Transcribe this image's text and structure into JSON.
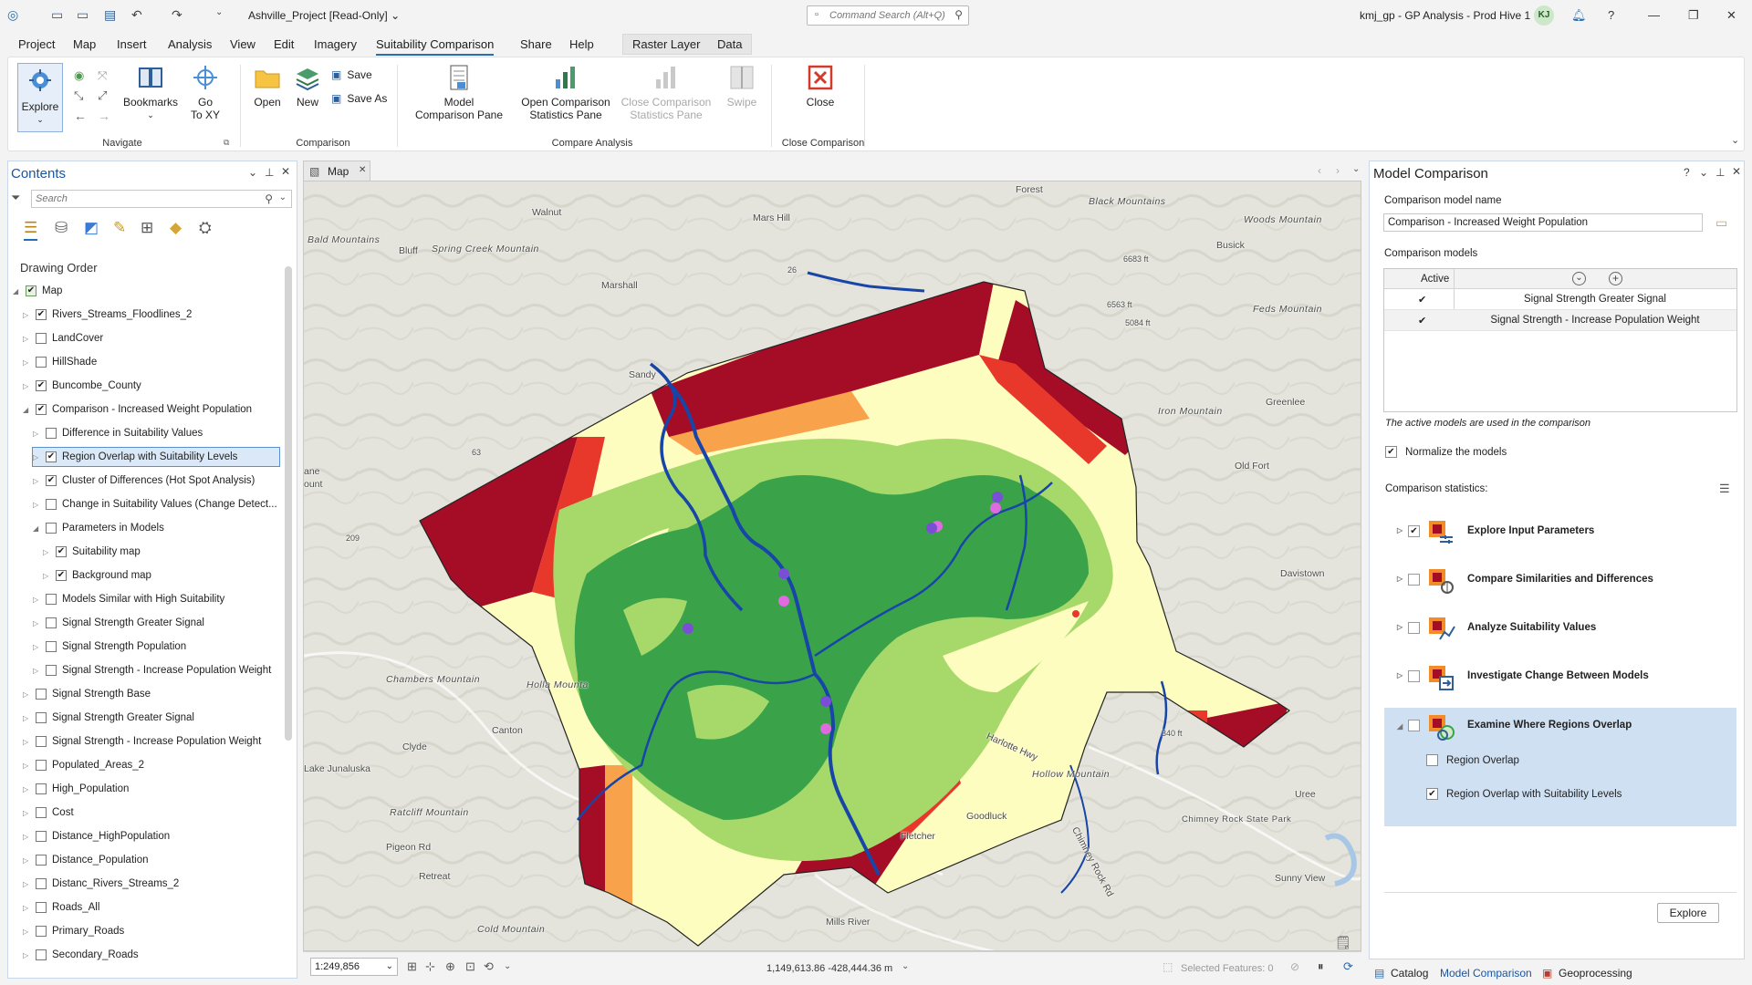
{
  "titlebar": {
    "project_title": "Ashville_Project [Read-Only] ⌄",
    "command_search_placeholder": "Command Search (Alt+Q)",
    "user_text": "kmj_gp - GP Analysis - Prod Hive 1",
    "avatar_initials": "KJ"
  },
  "menu": {
    "tabs": [
      "Project",
      "Map",
      "Insert",
      "Analysis",
      "View",
      "Edit",
      "Imagery",
      "Suitability Comparison",
      "Share",
      "Help"
    ],
    "context_tabs": [
      "Raster Layer",
      "Data"
    ]
  },
  "ribbon": {
    "navigate": {
      "explore": "Explore",
      "bookmarks": "Bookmarks",
      "goto_line1": "Go",
      "goto_line2": "To XY",
      "group": "Navigate"
    },
    "comparison": {
      "open": "Open",
      "new": "New",
      "save": "Save",
      "save_as": "Save As",
      "group": "Comparison"
    },
    "compare_analysis": {
      "model_pane_1": "Model",
      "model_pane_2": "Comparison Pane",
      "open_stats_1": "Open Comparison",
      "open_stats_2": "Statistics Pane",
      "close_stats_1": "Close Comparison",
      "close_stats_2": "Statistics Pane",
      "swipe": "Swipe",
      "group": "Compare Analysis"
    },
    "close_comparison": {
      "close": "Close",
      "group": "Close Comparison"
    }
  },
  "contents": {
    "title": "Contents",
    "search_placeholder": "Search",
    "drawing_order": "Drawing Order",
    "layers": [
      {
        "label": "Map",
        "level": 0,
        "checked": true,
        "expanded": true
      },
      {
        "label": "Rivers_Streams_Floodlines_2",
        "level": 1,
        "checked": true
      },
      {
        "label": "LandCover",
        "level": 1,
        "checked": false
      },
      {
        "label": "HillShade",
        "level": 1,
        "checked": false
      },
      {
        "label": "Buncombe_County",
        "level": 1,
        "checked": true
      },
      {
        "label": "Comparison - Increased Weight Population",
        "level": 1,
        "checked": true,
        "expanded": true
      },
      {
        "label": "Difference in Suitability Values",
        "level": 2,
        "checked": false
      },
      {
        "label": "Region Overlap with Suitability Levels",
        "level": 2,
        "checked": true,
        "selected": true
      },
      {
        "label": "Cluster of Differences (Hot Spot Analysis)",
        "level": 2,
        "checked": true
      },
      {
        "label": "Change in Suitability Values (Change Detect...",
        "level": 2,
        "checked": false
      },
      {
        "label": "Parameters in Models",
        "level": 2,
        "checked": false,
        "expanded": true
      },
      {
        "label": "Suitability map",
        "level": 3,
        "checked": true
      },
      {
        "label": "Background map",
        "level": 3,
        "checked": true
      },
      {
        "label": "Models Similar with High Suitability",
        "level": 2,
        "checked": false
      },
      {
        "label": "Signal Strength Greater Signal",
        "level": 2,
        "checked": false
      },
      {
        "label": "Signal Strength Population",
        "level": 2,
        "checked": false
      },
      {
        "label": "Signal Strength - Increase Population Weight",
        "level": 2,
        "checked": false
      },
      {
        "label": "Signal Strength Base",
        "level": 1,
        "checked": false
      },
      {
        "label": "Signal Strength Greater Signal",
        "level": 1,
        "checked": false
      },
      {
        "label": "Signal Strength - Increase Population Weight",
        "level": 1,
        "checked": false
      },
      {
        "label": "Populated_Areas_2",
        "level": 1,
        "checked": false
      },
      {
        "label": "High_Population",
        "level": 1,
        "checked": false
      },
      {
        "label": "Cost",
        "level": 1,
        "checked": false
      },
      {
        "label": "Distance_HighPopulation",
        "level": 1,
        "checked": false
      },
      {
        "label": "Distance_Population",
        "level": 1,
        "checked": false
      },
      {
        "label": "Distanc_Rivers_Streams_2",
        "level": 1,
        "checked": false
      },
      {
        "label": "Roads_All",
        "level": 1,
        "checked": false
      },
      {
        "label": "Primary_Roads",
        "level": 1,
        "checked": false
      },
      {
        "label": "Secondary_Roads",
        "level": 1,
        "checked": false
      }
    ]
  },
  "map": {
    "tab_label": "Map",
    "scale": "1:249,856",
    "coordinates": "1,149,613.86 -428,444.36 m",
    "selected_features": "Selected Features: 0",
    "places": [
      "Forest",
      "Walnut",
      "Mars Hill",
      "Black Mountains",
      "Woods Mountain",
      "Bald Mountains",
      "Bluff",
      "Spring Creek Mountain",
      "Busick",
      "6683 ft",
      "6563 ft",
      "Feds Mountain",
      "5084 ft",
      "Marshall",
      "26",
      "Sandy",
      "Greenlee",
      "Iron Mountain",
      "63",
      "Old Fort",
      "ane",
      "ount",
      "209",
      "Davistown",
      "Chambers Mountain",
      "Holla Mounta",
      "Canton",
      "Clyde",
      "Lake Junaluska",
      "Harlotte Hwy",
      "Hollow Mountain",
      "340 ft",
      "Ratcliff Mountain",
      "Pigeon Rd",
      "Goodluck",
      "Fletcher",
      "Chimney Rock State Park",
      "Uree",
      "Retreat",
      "Sunny View",
      "Chimney Rock Rd",
      "Cold Mountain",
      "Mills River"
    ]
  },
  "model_comparison": {
    "title": "Model Comparison",
    "name_label": "Comparison model name",
    "name_value": "Comparison - Increased Weight Population",
    "models_label": "Comparison models",
    "active_header": "Active",
    "models": [
      {
        "name": "Signal Strength Greater Signal",
        "active": true
      },
      {
        "name": "Signal Strength - Increase Population Weight",
        "active": true
      }
    ],
    "active_note": "The active models are used in the comparison",
    "normalize_label": "Normalize the models",
    "stats_label": "Comparison statistics:",
    "statistics": [
      {
        "label": "Explore Input Parameters",
        "checked": true
      },
      {
        "label": "Compare Similarities and Differences",
        "checked": false
      },
      {
        "label": "Analyze Suitability Values",
        "checked": false
      },
      {
        "label": "Investigate Change Between Models",
        "checked": false
      },
      {
        "label": "Examine Where Regions Overlap",
        "checked": false,
        "expanded": true
      }
    ],
    "sub_items": [
      {
        "label": "Region Overlap",
        "checked": false
      },
      {
        "label": "Region Overlap with Suitability Levels",
        "checked": true
      }
    ],
    "explore_button": "Explore"
  },
  "bottom_tabs": [
    "Catalog",
    "Model Comparison",
    "Geoprocessing"
  ],
  "colors": {
    "accent": "#1a55a3",
    "suit_dark_red": "#a50d27",
    "suit_red": "#e8382b",
    "suit_orange": "#f8a24c",
    "suit_yellow": "#fefdc0",
    "suit_light_green": "#a6d96a",
    "suit_green": "#3aa34a",
    "river_blue": "#1745a8"
  }
}
